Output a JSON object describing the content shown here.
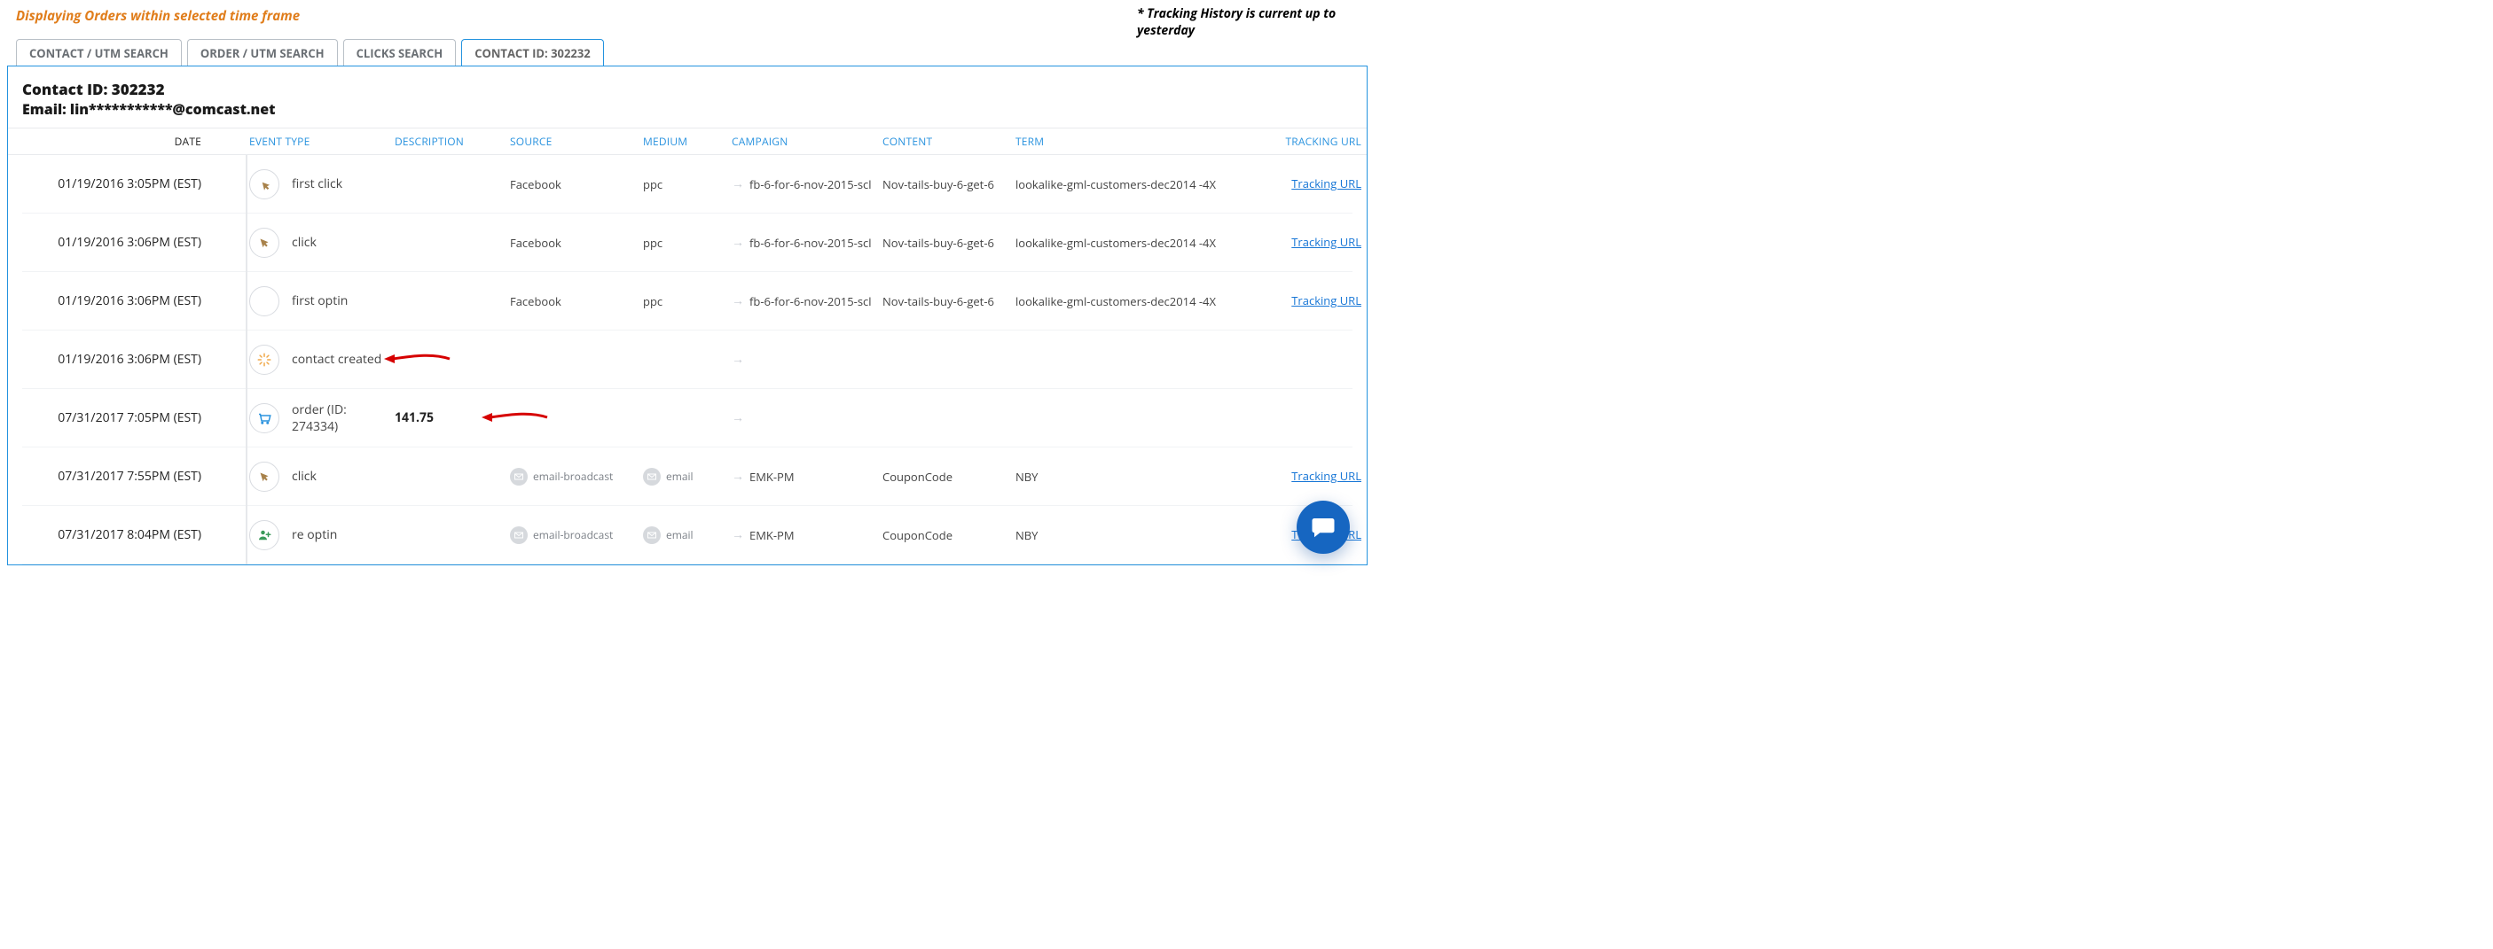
{
  "topbar": {
    "left_notice": "Displaying Orders within selected time frame",
    "right_notice": "* Tracking History is current up to yesterday"
  },
  "tabs": [
    {
      "label": "CONTACT / UTM SEARCH",
      "active": false
    },
    {
      "label": "ORDER / UTM SEARCH",
      "active": false
    },
    {
      "label": "CLICKS SEARCH",
      "active": false
    },
    {
      "label": "CONTACT ID: 302232",
      "active": true
    }
  ],
  "panel": {
    "title": "Contact ID: 302232",
    "email_label": "Email: lin***********@comcast.net"
  },
  "columns": {
    "date": "DATE",
    "event_type": "EVENT TYPE",
    "description": "DESCRIPTION",
    "source": "SOURCE",
    "medium": "MEDIUM",
    "campaign": "CAMPAIGN",
    "content": "CONTENT",
    "term": "TERM",
    "tracking_url": "TRACKING URL"
  },
  "link_label": "Tracking URL",
  "rows": [
    {
      "date": "01/19/2016 3:05PM (EST)",
      "icon": "first-click",
      "event": "first click",
      "description": "",
      "source": "Facebook",
      "medium": "ppc",
      "campaign": "fb-6-for-6-nov-2015-scl",
      "content": "Nov-tails-buy-6-get-6",
      "term": "lookalike-gml-customers-dec2014 -4X",
      "has_url": true,
      "source_badge": false,
      "medium_badge": false
    },
    {
      "date": "01/19/2016 3:06PM (EST)",
      "icon": "click",
      "event": "click",
      "description": "",
      "source": "Facebook",
      "medium": "ppc",
      "campaign": "fb-6-for-6-nov-2015-scl",
      "content": "Nov-tails-buy-6-get-6",
      "term": "lookalike-gml-customers-dec2014 -4X",
      "has_url": true,
      "source_badge": false,
      "medium_badge": false
    },
    {
      "date": "01/19/2016 3:06PM (EST)",
      "icon": "optin",
      "event": "first optin",
      "description": "",
      "source": "Facebook",
      "medium": "ppc",
      "campaign": "fb-6-for-6-nov-2015-scl",
      "content": "Nov-tails-buy-6-get-6",
      "term": "lookalike-gml-customers-dec2014 -4X",
      "has_url": true,
      "source_badge": false,
      "medium_badge": false
    },
    {
      "date": "01/19/2016 3:06PM (EST)",
      "icon": "contact",
      "event": "contact created",
      "description": "",
      "source": "",
      "medium": "",
      "campaign": "",
      "content": "",
      "term": "",
      "has_url": false,
      "source_badge": false,
      "medium_badge": false
    },
    {
      "date": "07/31/2017 7:05PM (EST)",
      "icon": "order",
      "event": "order (ID: 274334)",
      "description": "141.75",
      "source": "",
      "medium": "",
      "campaign": "",
      "content": "",
      "term": "",
      "has_url": false,
      "source_badge": false,
      "medium_badge": false
    },
    {
      "date": "07/31/2017 7:55PM (EST)",
      "icon": "click",
      "event": "click",
      "description": "",
      "source": "email-broadcast",
      "medium": "email",
      "campaign": "EMK-PM",
      "content": "CouponCode",
      "term": "NBY",
      "has_url": true,
      "source_badge": true,
      "medium_badge": true
    },
    {
      "date": "07/31/2017 8:04PM (EST)",
      "icon": "reoptin",
      "event": "re optin",
      "description": "",
      "source": "email-broadcast",
      "medium": "email",
      "campaign": "EMK-PM",
      "content": "CouponCode",
      "term": "NBY",
      "has_url": true,
      "source_badge": true,
      "medium_badge": true
    }
  ],
  "annotations": [
    {
      "row_index": 3,
      "target": "event"
    },
    {
      "row_index": 4,
      "target": "description"
    }
  ]
}
